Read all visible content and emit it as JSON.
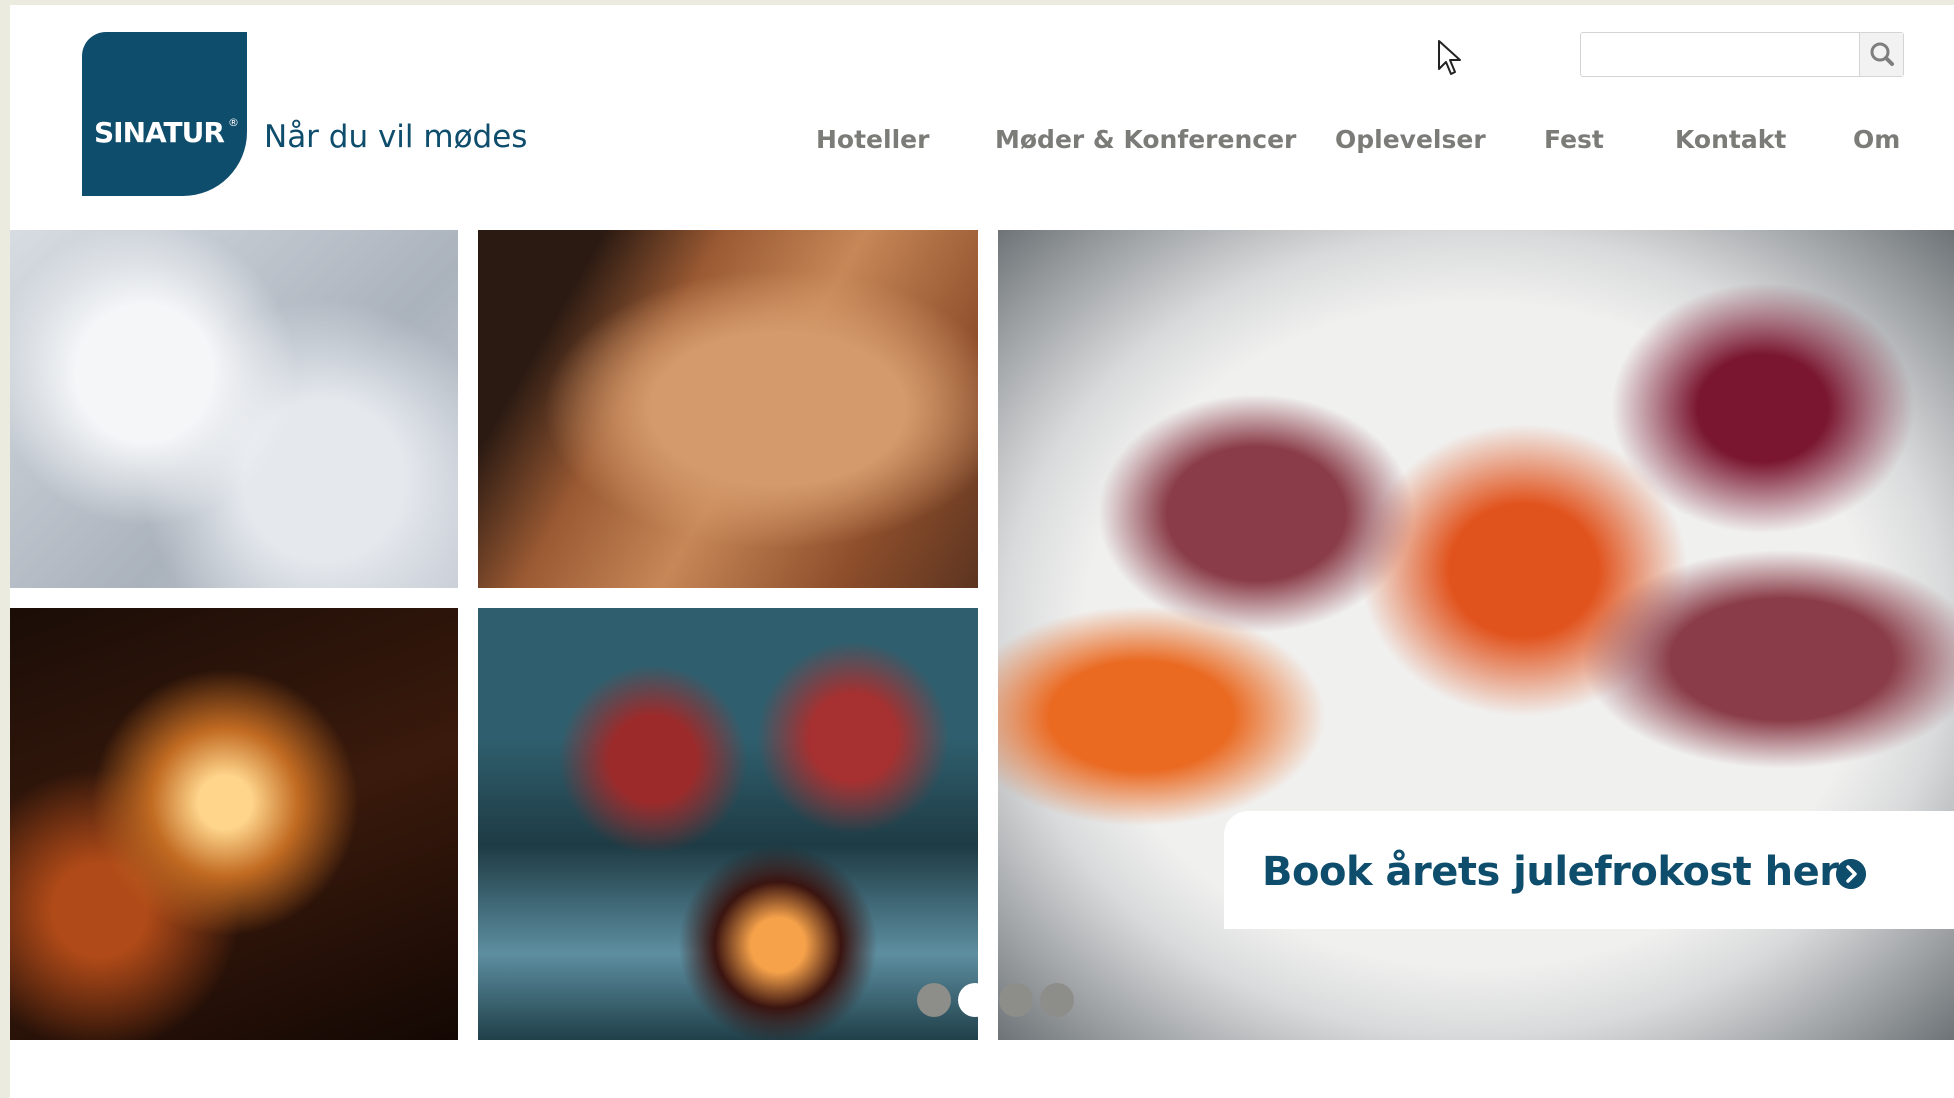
{
  "brand": {
    "logo_text": "SINATUR",
    "logo_reg": "®",
    "tagline": "Når du vil mødes"
  },
  "search": {
    "placeholder": "",
    "value": ""
  },
  "nav": {
    "items": [
      {
        "label": "Hoteller"
      },
      {
        "label": "Møder & Konferencer"
      },
      {
        "label": "Oplevelser"
      },
      {
        "label": "Fest"
      },
      {
        "label": "Kontakt"
      },
      {
        "label": "Om"
      }
    ]
  },
  "slider": {
    "dot_count": 4,
    "active_index": 1
  },
  "cta": {
    "label": "Book årets julefrokost her"
  },
  "colors": {
    "brand": "#0e4d6c",
    "nav_text": "#7b7b78",
    "page_bg": "#ecebdf"
  },
  "icons": {
    "search": "magnifier-icon",
    "cta_arrow": "circle-chevron-right-icon",
    "cursor": "mouse-pointer-icon"
  }
}
